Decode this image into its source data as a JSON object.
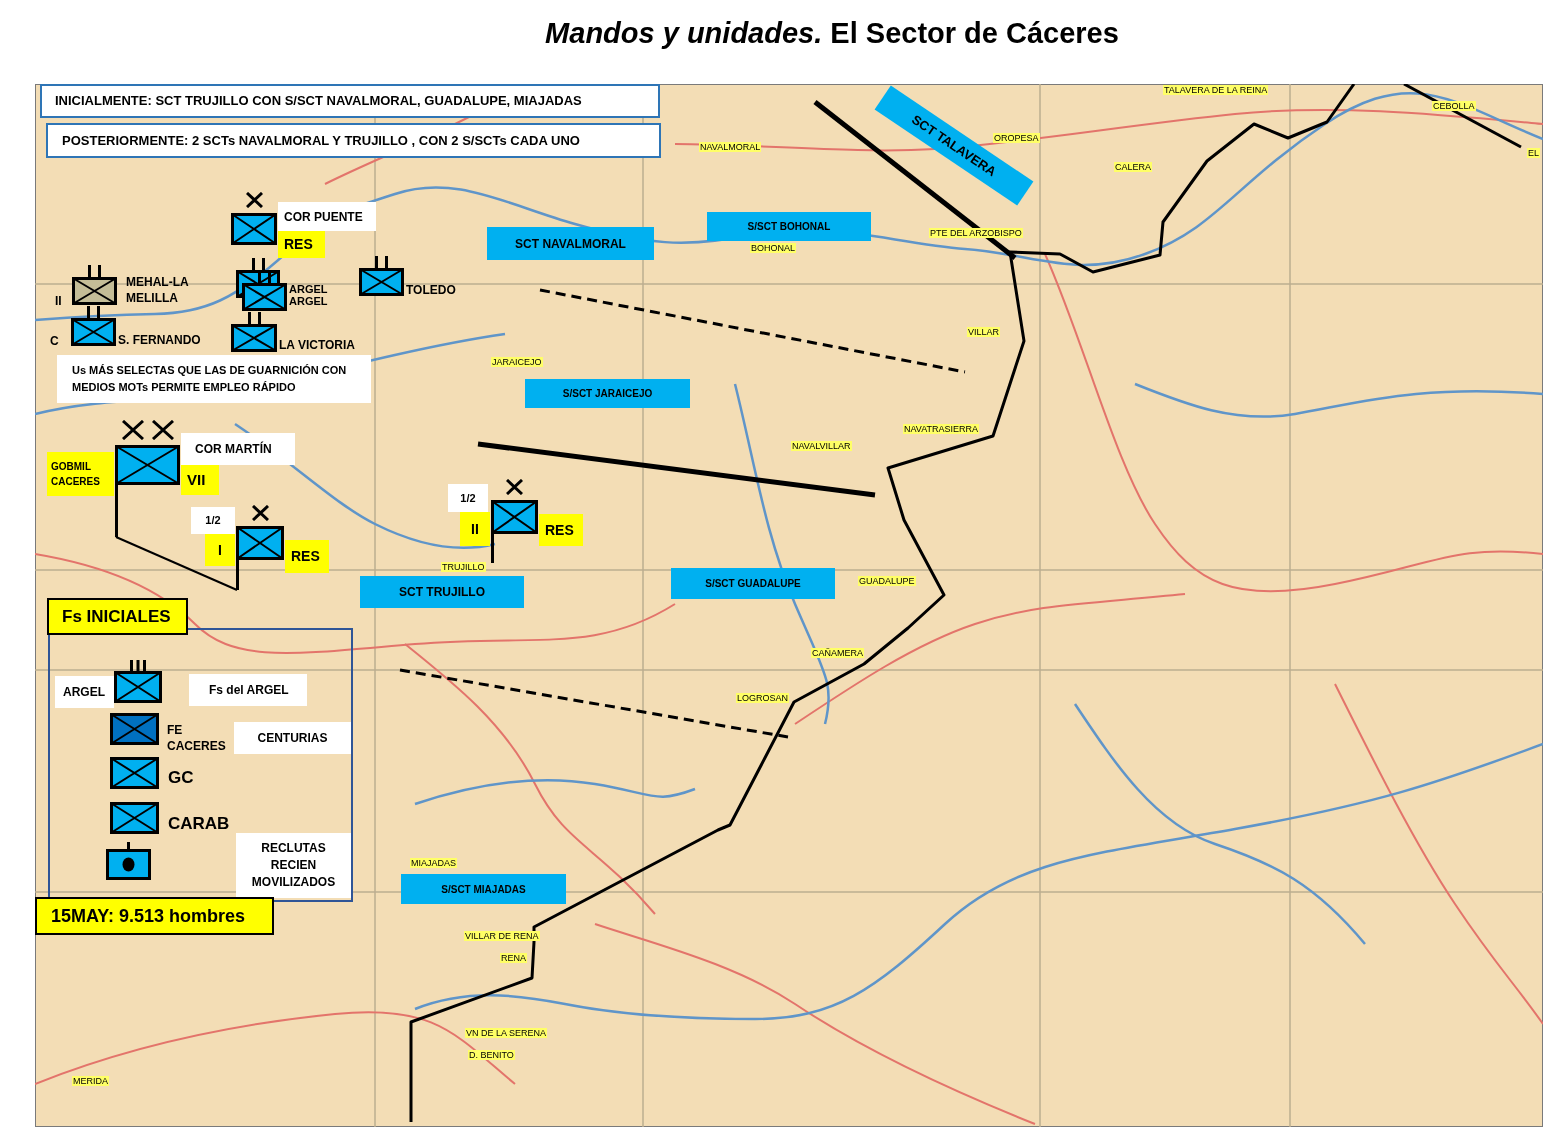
{
  "title": "*Mandos y unidades.* El Sector de Cáceres",
  "notes": [
    "INICIALMENTE: SCT TRUJILLO CON S/SCT NAVALMORAL, GUADALUPE, MIAJADAS",
    "POSTERIORMENTE: 2 SCTs NAVALMORAL Y TRUJILLO , CON 2 S/SCTs CADA UNO"
  ],
  "map": {
    "sectors": [
      "SCT NAVALMORAL",
      "S/SCT BOHONAL",
      "SCT TALAVERA",
      "S/SCT JARAICEJO",
      "SCT TRUJILLO",
      "S/SCT GUADALUPE",
      "S/SCT MIAJADAS"
    ],
    "places": [
      "TALAVERA DE LA REINA",
      "CEBOLLA",
      "OROPESA",
      "NAVALMORAL",
      "EL",
      "CALERA",
      "PTE DEL ARZOBISPO",
      "BOHONAL",
      "VILLAR",
      "JARAICEJO",
      "NAVATRASIERRA",
      "NAVALVILLAR",
      "TRUJILLO",
      "GUADALUPE",
      "CAÑAMERA",
      "LOGROSAN",
      "MIAJADAS",
      "VILLAR DE RENA",
      "RENA",
      "VN DE LA SERENA",
      "D. BENITO",
      "MERIDA"
    ],
    "fragments": [
      "II",
      "C"
    ],
    "units": [
      {
        "kind": "brigade",
        "color": "#00b0f0",
        "hq": false,
        "labels": [
          {
            "text": "COR PUENTE",
            "kind": "white"
          },
          {
            "text": "RES",
            "kind": "yellow"
          }
        ]
      },
      {
        "kind": "battalion",
        "color": "#c4bd97",
        "hq": false,
        "labels": [
          {
            "text": "MEHAL-LA MELILLA",
            "kind": "plain"
          }
        ]
      },
      {
        "kind": "battalion",
        "color": "#00b0f0",
        "hq": false,
        "labels": [
          {
            "text": "S. FERNANDO",
            "kind": "plain"
          }
        ]
      },
      {
        "kind": "battalion",
        "color": "#00b0f0",
        "hq": false,
        "labels": [
          {
            "text": "ARGEL",
            "kind": "plain"
          }
        ]
      },
      {
        "kind": "battalion",
        "color": "#00b0f0",
        "hq": false,
        "labels": [
          {
            "text": "ARGEL",
            "kind": "plain"
          }
        ]
      },
      {
        "kind": "battalion",
        "color": "#00b0f0",
        "hq": false,
        "labels": [
          {
            "text": "TOLEDO",
            "kind": "plain"
          }
        ]
      },
      {
        "kind": "battalion",
        "color": "#00b0f0",
        "hq": false,
        "labels": [
          {
            "text": "LA VICTORIA",
            "kind": "plain"
          }
        ]
      },
      {
        "kind": "division",
        "color": "#00b0f0",
        "hq": true,
        "labels": [
          {
            "text": "COR MARTÍN",
            "kind": "white"
          },
          {
            "text": "GOBMIL CACERES",
            "kind": "yellow"
          },
          {
            "text": "VII",
            "kind": "yellow"
          }
        ]
      },
      {
        "kind": "brigade",
        "color": "#00b0f0",
        "hq": true,
        "labels": [
          {
            "text": "1/2",
            "kind": "white"
          },
          {
            "text": "I",
            "kind": "yellow"
          },
          {
            "text": "RES",
            "kind": "yellow"
          }
        ]
      },
      {
        "kind": "brigade",
        "color": "#00b0f0",
        "hq": true,
        "labels": [
          {
            "text": "1/2",
            "kind": "white"
          },
          {
            "text": "II",
            "kind": "yellow"
          },
          {
            "text": "RES",
            "kind": "yellow"
          }
        ]
      }
    ],
    "remark": "Us MÁS SELECTAS QUE LAS DE GUARNICIÓN CON MEDIOS MOTs PERMITE EMPLEO RÁPIDO"
  },
  "initial_forces": {
    "title": "Fs INICIALES",
    "items": [
      {
        "kind": "regiment",
        "color": "#00b0f0",
        "label": "ARGEL",
        "note": "Fs del ARGEL"
      },
      {
        "kind": "plain",
        "color": "#0070c0",
        "name": "FE CACERES",
        "note": "CENTURIAS"
      },
      {
        "kind": "plain",
        "color": "#00b0f0",
        "name": "GC"
      },
      {
        "kind": "plain",
        "color": "#00b0f0",
        "name": "CARAB"
      },
      {
        "kind": "company",
        "color": "#00b0f0",
        "note": "RECLUTAS RECIEN MOVILIZADOS"
      }
    ],
    "total": "15MAY: 9.513 hombres"
  }
}
